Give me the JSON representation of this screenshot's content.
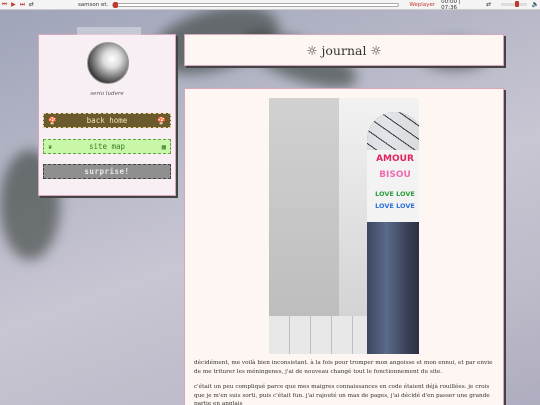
{
  "player": {
    "track": "samson et. c",
    "player_name": "Weplayer",
    "time": "00:00 | 07:36"
  },
  "sidebar": {
    "caption": "serio ludere",
    "nav": [
      {
        "label": "back home"
      },
      {
        "label": "site map"
      },
      {
        "label": "surprise!"
      }
    ]
  },
  "header": {
    "title": "☼ journal ☼"
  },
  "post": {
    "photo_alt": "painted bollard with sticker",
    "sticker_lines": [
      "AMOUR",
      "BISOU",
      "LOVE LOVE",
      "LOVE LOVE"
    ],
    "paragraphs": [
      "décidément, me voilà bien inconsistant. à la fois pour tromper mon angoisse et mon ennui, et par envie de me triturer les méningenes, j'ai de nouveau changé tout le fonctionnement du site.",
      "c'était un peu compliqué parce que mes maigres connaissances en code étaient déjà rouillées. je crois que je m'en suis sorti, puis c'était fun. j'ai rajouté un max de pages, j'ai décidé d'en passer une grande partie en anglais"
    ]
  },
  "colors": {
    "accent": "#c0392b",
    "panel_border": "#d7a8bb",
    "panel_bg": "#fdf6f2"
  }
}
